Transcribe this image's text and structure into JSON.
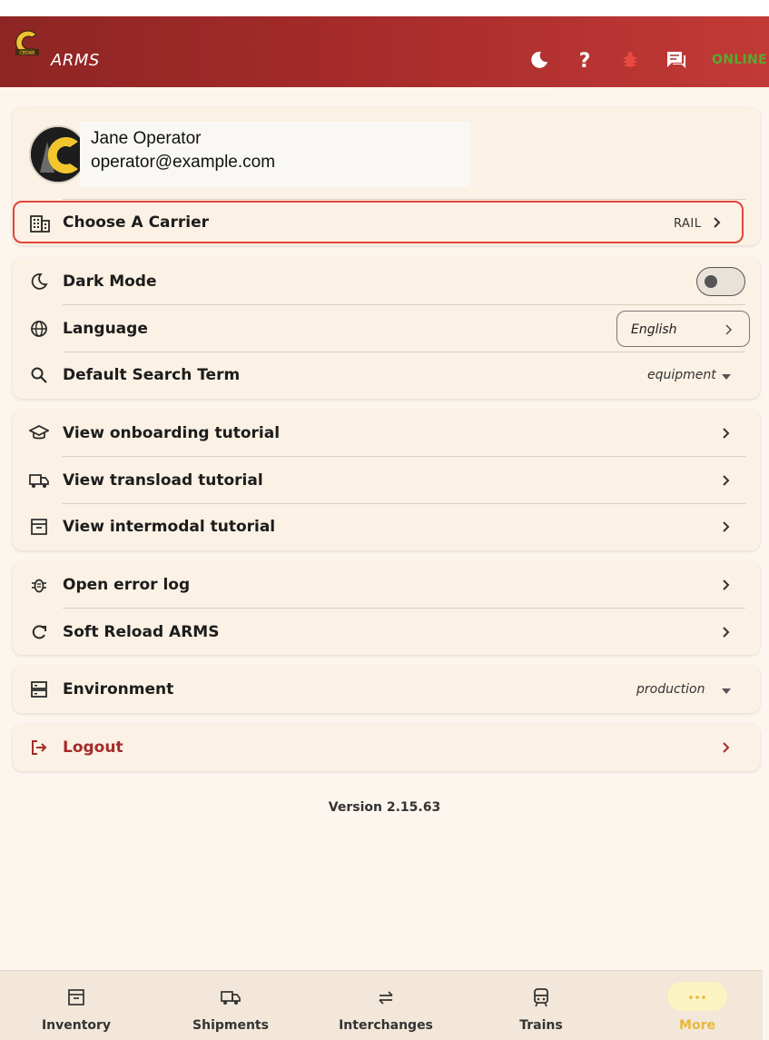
{
  "header": {
    "app_name": "ARMS",
    "logo_text": "CEDAR",
    "status": "ONLINE",
    "icons": [
      "moon-icon",
      "help-icon",
      "bug-icon",
      "chat-icon"
    ]
  },
  "profile": {
    "name": "Jane Operator",
    "email": "operator@example.com"
  },
  "carrier": {
    "label": "Choose A Carrier",
    "value": "RAIL"
  },
  "preferences": {
    "dark_mode_label": "Dark Mode",
    "dark_mode_on": false,
    "language_label": "Language",
    "language_value": "English",
    "search_label": "Default Search Term",
    "search_value": "equipment"
  },
  "tutorials": {
    "onboarding": "View onboarding tutorial",
    "transload": "View transload tutorial",
    "intermodal": "View intermodal tutorial"
  },
  "tools": {
    "error_log": "Open error log",
    "soft_reload": "Soft Reload ARMS"
  },
  "environment": {
    "label": "Environment",
    "value": "production"
  },
  "logout": {
    "label": "Logout"
  },
  "version": "Version 2.15.63",
  "nav": {
    "inventory": "Inventory",
    "shipments": "Shipments",
    "interchanges": "Interchanges",
    "trains": "Trains",
    "more": "More"
  },
  "colors": {
    "header_start": "#8e2524",
    "header_end": "#c23a36",
    "online": "#5aa832",
    "highlight": "#e0463c",
    "logout": "#a52b2a",
    "active_nav": "#e8b83a"
  }
}
